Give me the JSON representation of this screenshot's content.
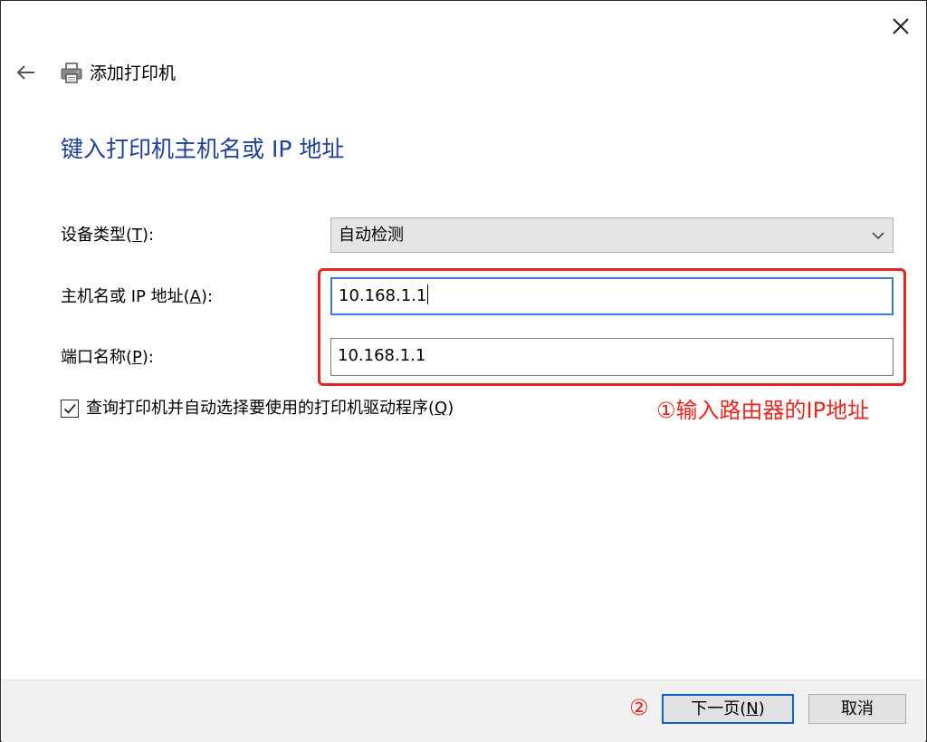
{
  "window": {
    "title": "添加打印机"
  },
  "page": {
    "heading": "键入打印机主机名或 IP 地址"
  },
  "form": {
    "device_type": {
      "label": "设备类型",
      "mnemonic": "T",
      "value": "自动检测"
    },
    "host": {
      "label": "主机名或 IP 地址",
      "mnemonic": "A",
      "value": "10.168.1.1"
    },
    "port": {
      "label": "端口名称",
      "mnemonic": "P",
      "value": "10.168.1.1"
    },
    "query_driver": {
      "label": "查询打印机并自动选择要使用的打印机驱动程序",
      "mnemonic": "Q",
      "checked": true
    }
  },
  "annotations": {
    "step1": "①输入路由器的IP地址",
    "step2": "②"
  },
  "footer": {
    "next": {
      "label": "下一页",
      "mnemonic": "N"
    },
    "cancel": {
      "label": "取消"
    }
  },
  "colors": {
    "heading": "#1f3f9a",
    "annotation": "#e8251f",
    "focus": "#3d7bd4"
  },
  "icons": [
    "close-icon",
    "back-arrow-icon",
    "printer-icon",
    "chevron-down-icon",
    "checkmark-icon"
  ]
}
